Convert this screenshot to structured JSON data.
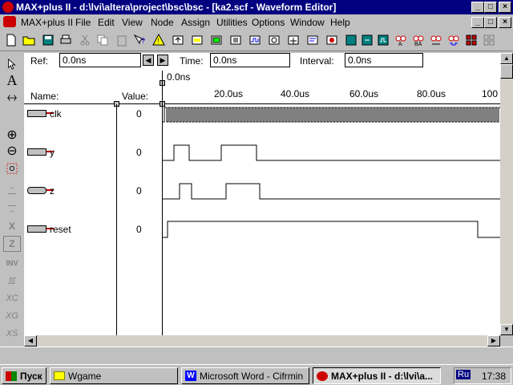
{
  "window": {
    "title": "MAX+plus II - d:\\lvi\\altera\\project\\bsc\\bsc - [ka2.scf - Waveform Editor]",
    "minimize_label": "_",
    "maximize_label": "□",
    "close_label": "×"
  },
  "menu": {
    "app_menu": "MAX+plus II",
    "items": [
      "File",
      "Edit",
      "View",
      "Node",
      "Assign",
      "Utilities",
      "Options",
      "Window",
      "Help"
    ]
  },
  "timebar": {
    "ref_label": "Ref:",
    "ref_value": "0.0ns",
    "time_label": "Time:",
    "time_value": "0.0ns",
    "interval_label": "Interval:",
    "interval_value": "0.0ns",
    "cursor_time": "0.0ns"
  },
  "columns": {
    "name_header": "Name:",
    "value_header": "Value:"
  },
  "ruler": {
    "ticks": [
      "20.0us",
      "40.0us",
      "60.0us",
      "80.0us",
      "100"
    ]
  },
  "signals": [
    {
      "name": "clk",
      "value": "0",
      "type": "input"
    },
    {
      "name": "y",
      "value": "0",
      "type": "output"
    },
    {
      "name": "z",
      "value": "0",
      "type": "output"
    },
    {
      "name": "reset",
      "value": "0",
      "type": "input"
    }
  ],
  "left_tools": {
    "zoom_in": "⊕",
    "zoom_out": "⊖",
    "text_tool": "A",
    "inv_label": "INV",
    "z_label": "Z",
    "xc_label": "XC",
    "xg_label": "XG",
    "xs_label": "XS",
    "x_label": "X"
  },
  "taskbar": {
    "start_label": "Пуск",
    "tasks": [
      "Wgame",
      "Microsoft Word - Cifrmin",
      "MAX+plus II - d:\\lvi\\a..."
    ],
    "language": "Ru",
    "clock": "17:38"
  }
}
